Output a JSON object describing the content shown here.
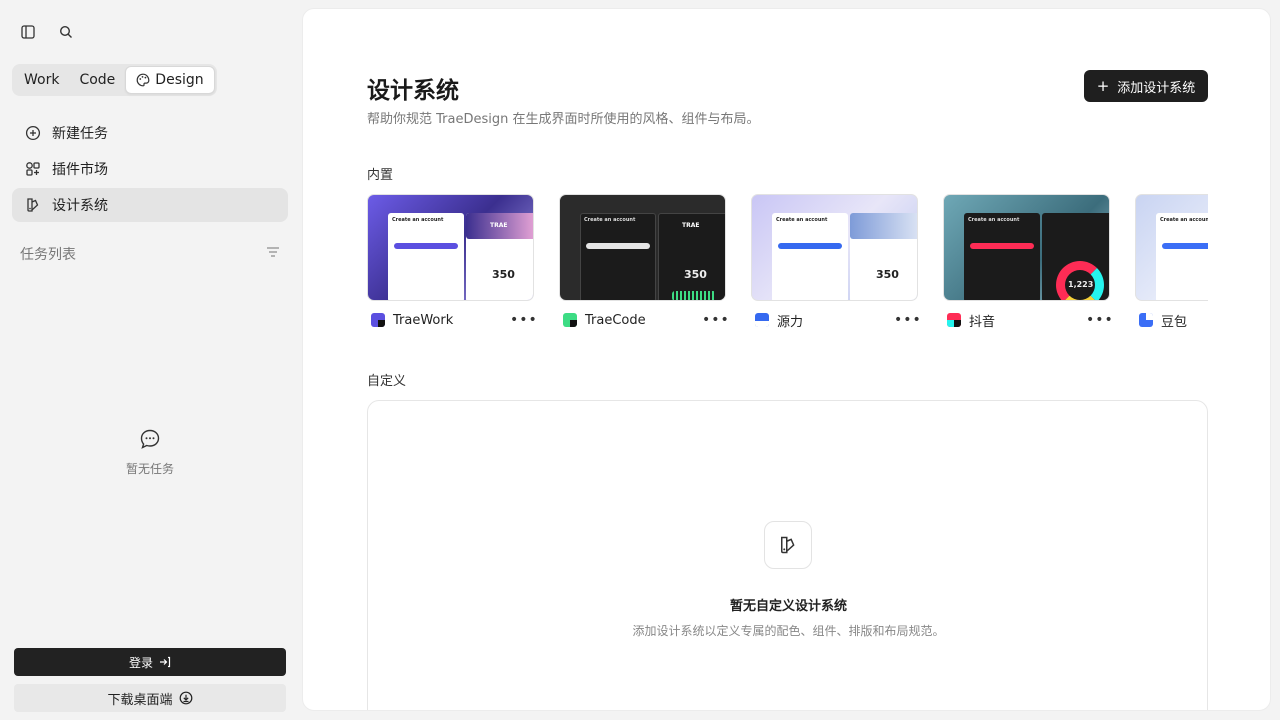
{
  "sidebar": {
    "toggle_icon": "sidebar-toggle-icon",
    "search_icon": "search-icon",
    "modes": [
      {
        "label": "Work"
      },
      {
        "label": "Code"
      },
      {
        "label": "Design",
        "icon": "palette-icon"
      }
    ],
    "active_mode": "Design",
    "nav": [
      {
        "label": "新建任务",
        "icon": "plus-circle-icon"
      },
      {
        "label": "插件市场",
        "icon": "plugin-grid-icon"
      },
      {
        "label": "设计系统",
        "icon": "design-system-icon"
      }
    ],
    "tasks_header": "任务列表",
    "filter_icon": "filter-icon",
    "empty_tasks": "暂无任务",
    "login_label": "登录",
    "download_label": "下载桌面端"
  },
  "main": {
    "title": "设计系统",
    "subtitle": "帮助你规范 TraeDesign 在生成界面时所使用的风格、组件与布局。",
    "add_button": "添加设计系统",
    "builtin_label": "内置",
    "builtin": [
      {
        "name": "TraeWork",
        "accent": "#5b4fe0",
        "theme": "light",
        "brand": "TRAE",
        "number": "350"
      },
      {
        "name": "TraeCode",
        "accent": "#3ddc84",
        "theme": "dark",
        "brand": "TRAE",
        "number": "350"
      },
      {
        "name": "源力",
        "accent": "#3569f0",
        "theme": "light",
        "brand": "",
        "number": "350"
      },
      {
        "name": "抖音",
        "accent": "#fe2c55",
        "theme": "dark",
        "brand": "",
        "number": "1,223"
      },
      {
        "name": "豆包",
        "accent": "#3b6ef6",
        "theme": "light",
        "brand": "",
        "number": ""
      }
    ],
    "thumb_heading": "Create an account",
    "custom_label": "自定义",
    "custom_empty_title": "暂无自定义设计系统",
    "custom_empty_desc": "添加设计系统以定义专属的配色、组件、排版和布局规范。"
  }
}
